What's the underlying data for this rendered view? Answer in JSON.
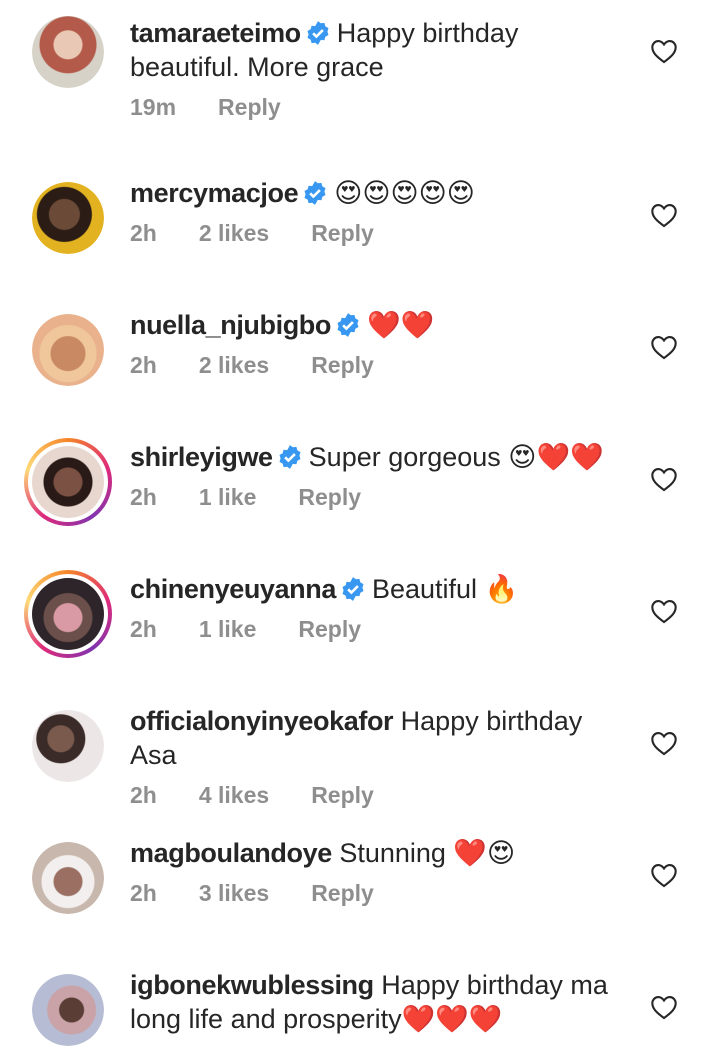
{
  "comments": [
    {
      "username": "tamaraeteimo",
      "text": "Happy birthday beautiful. More grace",
      "time": "19m",
      "likes": "",
      "reply": "Reply",
      "avatar_color": "#c86a58"
    },
    {
      "username": "mercymacjoe",
      "text": "😍😍😍😍😍",
      "time": "2h",
      "likes": "2 likes",
      "reply": "Reply",
      "avatar_color": "#d6a41a"
    },
    {
      "username": "nuella_njubigbo",
      "text": "❤️❤️",
      "time": "2h",
      "likes": "2 likes",
      "reply": "Reply",
      "avatar_color": "#c8906a"
    },
    {
      "username": "shirleyigwe",
      "text": "Super gorgeous 😍❤️❤️",
      "time": "2h",
      "likes": "1 like",
      "reply": "Reply",
      "avatar_color": "#d9c3b5"
    },
    {
      "username": "chinenyeuyanna",
      "text": "Beautiful 🔥",
      "time": "2h",
      "likes": "1 like",
      "reply": "Reply",
      "avatar_color": "#3c2f36"
    },
    {
      "username": "officialonyinyeokafor",
      "text": "Happy birthday Asa",
      "time": "2h",
      "likes": "4 likes",
      "reply": "Reply",
      "avatar_color": "#e4dcdc"
    },
    {
      "username": "magboulandoye",
      "text": "Stunning ❤️😍",
      "time": "2h",
      "likes": "3 likes",
      "reply": "Reply",
      "avatar_color": "#bfa08f"
    },
    {
      "username": "igbonekwublessing",
      "text": "Happy birthday ma long life and prosperity❤️❤️❤️",
      "time": "",
      "likes": "",
      "reply": "",
      "avatar_color": "#a1a6c0"
    }
  ],
  "colors": {
    "verified": "#3897f0",
    "meta": "#8e8e8e",
    "text": "#262626"
  },
  "icons": {
    "verified": "verified-badge-icon",
    "like": "heart-outline-icon"
  }
}
